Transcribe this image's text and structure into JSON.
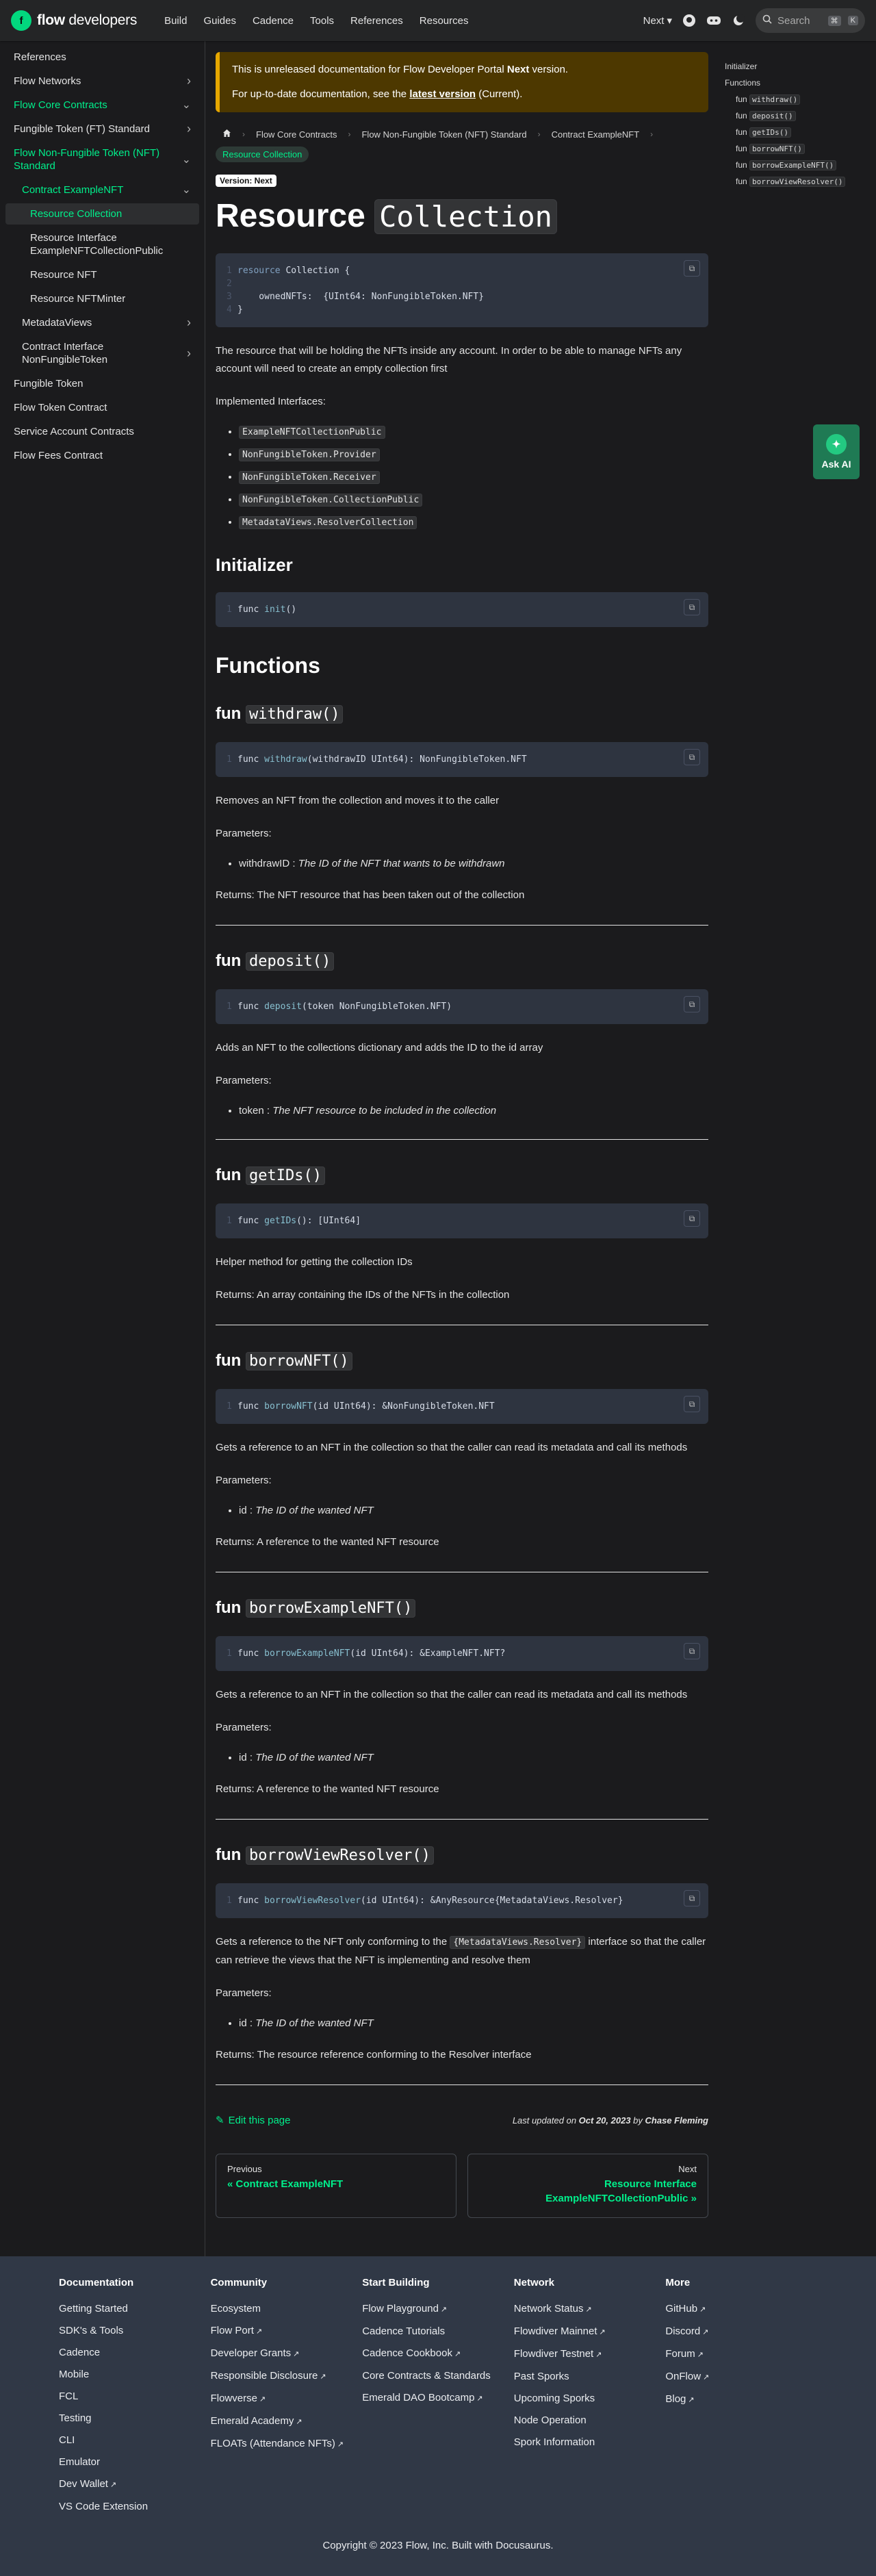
{
  "nav": {
    "brand_bold": "flow",
    "brand_rest": "developers",
    "links": [
      "Build",
      "Guides",
      "Cadence",
      "Tools",
      "References",
      "Resources"
    ],
    "version": "Next",
    "search_placeholder": "Search",
    "kbd1": "⌘",
    "kbd2": "K"
  },
  "sidebar": {
    "items": [
      {
        "label": "References",
        "level": 0,
        "chev": ""
      },
      {
        "label": "Flow Networks",
        "level": 0,
        "chev": ">"
      },
      {
        "label": "Flow Core Contracts",
        "level": 0,
        "chev": "v",
        "state": "active"
      },
      {
        "label": "Fungible Token (FT) Standard",
        "level": 1,
        "chev": ">"
      },
      {
        "label": "Flow Non-Fungible Token (NFT) Standard",
        "level": 1,
        "chev": "v",
        "state": "active"
      },
      {
        "label": "Contract ExampleNFT",
        "level": 2,
        "chev": "v",
        "state": "active"
      },
      {
        "label": "Resource Collection",
        "level": 3,
        "chev": "",
        "state": "sel"
      },
      {
        "label": "Resource Interface ExampleNFTCollectionPublic",
        "level": 3,
        "chev": ""
      },
      {
        "label": "Resource NFT",
        "level": 3,
        "chev": ""
      },
      {
        "label": "Resource NFTMinter",
        "level": 3,
        "chev": ""
      },
      {
        "label": "MetadataViews",
        "level": 2,
        "chev": ">"
      },
      {
        "label": "Contract Interface NonFungibleToken",
        "level": 2,
        "chev": ">"
      },
      {
        "label": "Fungible Token",
        "level": 1,
        "chev": ""
      },
      {
        "label": "Flow Token Contract",
        "level": 1,
        "chev": ""
      },
      {
        "label": "Service Account Contracts",
        "level": 1,
        "chev": ""
      },
      {
        "label": "Flow Fees Contract",
        "level": 1,
        "chev": ""
      }
    ]
  },
  "admonition": {
    "line1_pre": "This is unreleased documentation for Flow Developer Portal ",
    "line1_bold": "Next",
    "line1_post": " version.",
    "line2_pre": "For up-to-date documentation, see the ",
    "line2_link": "latest version",
    "line2_post": " (Current)."
  },
  "breadcrumbs": [
    "Flow Core Contracts",
    "Flow Non-Fungible Token (NFT) Standard",
    "Contract ExampleNFT",
    "Resource Collection"
  ],
  "version_badge": "Version: Next",
  "title_word": "Resource",
  "title_code": "Collection",
  "intro_code": {
    "l1a": "resource",
    "l1b": " Collection {",
    "l3": "    ownedNFTs:  {UInt64: NonFungibleToken.NFT}",
    "l4": "}"
  },
  "intro_text": "The resource that will be holding the NFTs inside any account. In order to be able to manage NFTs any account will need to create an empty collection first",
  "interfaces_label": "Implemented Interfaces:",
  "interfaces": [
    "ExampleNFTCollectionPublic",
    "NonFungibleToken.Provider",
    "NonFungibleToken.Receiver",
    "NonFungibleToken.CollectionPublic",
    "MetadataViews.ResolverCollection"
  ],
  "initializer": {
    "heading": "Initializer",
    "code_kw": "func",
    "code_fn": "init",
    "code_rest": "()"
  },
  "functions_heading": "Functions",
  "functions": [
    {
      "name": "withdraw()",
      "fn": "withdraw",
      "sig": "(withdrawID UInt64): NonFungibleToken.NFT",
      "desc": "Removes an NFT from the collection and moves it to the caller",
      "params_label": "Parameters:",
      "param_name": "withdrawID",
      "param_desc": "The ID of the NFT that wants to be withdrawn",
      "returns": "Returns: The NFT resource that has been taken out of the collection"
    },
    {
      "name": "deposit()",
      "fn": "deposit",
      "sig": "(token NonFungibleToken.NFT)",
      "desc": "Adds an NFT to the collections dictionary and adds the ID to the id array",
      "params_label": "Parameters:",
      "param_name": "token",
      "param_desc": "The NFT resource to be included in the collection",
      "returns": ""
    },
    {
      "name": "getIDs()",
      "fn": "getIDs",
      "sig": "(): [UInt64]",
      "desc": "Helper method for getting the collection IDs",
      "params_label": "",
      "param_name": "",
      "param_desc": "",
      "returns": "Returns: An array containing the IDs of the NFTs in the collection"
    },
    {
      "name": "borrowNFT()",
      "fn": "borrowNFT",
      "sig": "(id UInt64): &NonFungibleToken.NFT",
      "desc": "Gets a reference to an NFT in the collection so that the caller can read its metadata and call its methods",
      "params_label": "Parameters:",
      "param_name": "id",
      "param_desc": "The ID of the wanted NFT",
      "returns": "Returns: A reference to the wanted NFT resource"
    },
    {
      "name": "borrowExampleNFT()",
      "fn": "borrowExampleNFT",
      "sig": "(id UInt64): &ExampleNFT.NFT?",
      "desc": "Gets a reference to an NFT in the collection so that the caller can read its metadata and call its methods",
      "params_label": "Parameters:",
      "param_name": "id",
      "param_desc": "The ID of the wanted NFT",
      "returns": "Returns: A reference to the wanted NFT resource"
    },
    {
      "name": "borrowViewResolver()",
      "fn": "borrowViewResolver",
      "sig": "(id UInt64): &AnyResource{MetadataViews.Resolver}",
      "desc_pre": "Gets a reference to the NFT only conforming to the ",
      "desc_code": "{MetadataViews.Resolver}",
      "desc_post": " interface so that the caller can retrieve the views that the NFT is implementing and resolve them",
      "params_label": "Parameters:",
      "param_name": "id",
      "param_desc": "The ID of the wanted NFT",
      "returns": "Returns: The resource reference conforming to the Resolver interface"
    }
  ],
  "edit_label": "Edit this page",
  "updated_pre": "Last updated on ",
  "updated_date": "Oct 20, 2023",
  "updated_by": " by ",
  "updated_author": "Chase Fleming",
  "pager": {
    "prev_label": "Previous",
    "prev_title": "« Contract ExampleNFT",
    "next_label": "Next",
    "next_title": "Resource Interface ExampleNFTCollectionPublic »"
  },
  "toc": {
    "items": [
      "Initializer",
      "Functions"
    ],
    "fns": [
      "withdraw()",
      "deposit()",
      "getIDs()",
      "borrowNFT()",
      "borrowExampleNFT()",
      "borrowViewResolver()"
    ]
  },
  "ask_ai": "Ask AI",
  "footer": {
    "cols": [
      {
        "title": "Documentation",
        "links": [
          {
            "t": "Getting Started",
            "e": false
          },
          {
            "t": "SDK's & Tools",
            "e": false
          },
          {
            "t": "Cadence",
            "e": false
          },
          {
            "t": "Mobile",
            "e": false
          },
          {
            "t": "FCL",
            "e": false
          },
          {
            "t": "Testing",
            "e": false
          },
          {
            "t": "CLI",
            "e": false
          },
          {
            "t": "Emulator",
            "e": false
          },
          {
            "t": "Dev Wallet",
            "e": true
          },
          {
            "t": "VS Code Extension",
            "e": false
          }
        ]
      },
      {
        "title": "Community",
        "links": [
          {
            "t": "Ecosystem",
            "e": false
          },
          {
            "t": "Flow Port",
            "e": true
          },
          {
            "t": "Developer Grants",
            "e": true
          },
          {
            "t": "Responsible Disclosure",
            "e": true
          },
          {
            "t": "Flowverse",
            "e": true
          },
          {
            "t": "Emerald Academy",
            "e": true
          },
          {
            "t": "FLOATs (Attendance NFTs)",
            "e": true
          }
        ]
      },
      {
        "title": "Start Building",
        "links": [
          {
            "t": "Flow Playground",
            "e": true
          },
          {
            "t": "Cadence Tutorials",
            "e": false
          },
          {
            "t": "Cadence Cookbook",
            "e": true
          },
          {
            "t": "Core Contracts & Standards",
            "e": false
          },
          {
            "t": "Emerald DAO Bootcamp",
            "e": true
          }
        ]
      },
      {
        "title": "Network",
        "links": [
          {
            "t": "Network Status",
            "e": true
          },
          {
            "t": "Flowdiver Mainnet",
            "e": true
          },
          {
            "t": "Flowdiver Testnet",
            "e": true
          },
          {
            "t": "Past Sporks",
            "e": false
          },
          {
            "t": "Upcoming Sporks",
            "e": false
          },
          {
            "t": "Node Operation",
            "e": false
          },
          {
            "t": "Spork Information",
            "e": false
          }
        ]
      },
      {
        "title": "More",
        "links": [
          {
            "t": "GitHub",
            "e": true
          },
          {
            "t": "Discord",
            "e": true
          },
          {
            "t": "Forum",
            "e": true
          },
          {
            "t": "OnFlow",
            "e": true
          },
          {
            "t": "Blog",
            "e": true
          }
        ]
      }
    ],
    "copyright": "Copyright © 2023 Flow, Inc. Built with Docusaurus."
  },
  "colors": {
    "accent": "#00ef8b",
    "admonition_bg": "#4d3800",
    "footer_bg": "#303846",
    "code_bg": "#2e3440"
  }
}
